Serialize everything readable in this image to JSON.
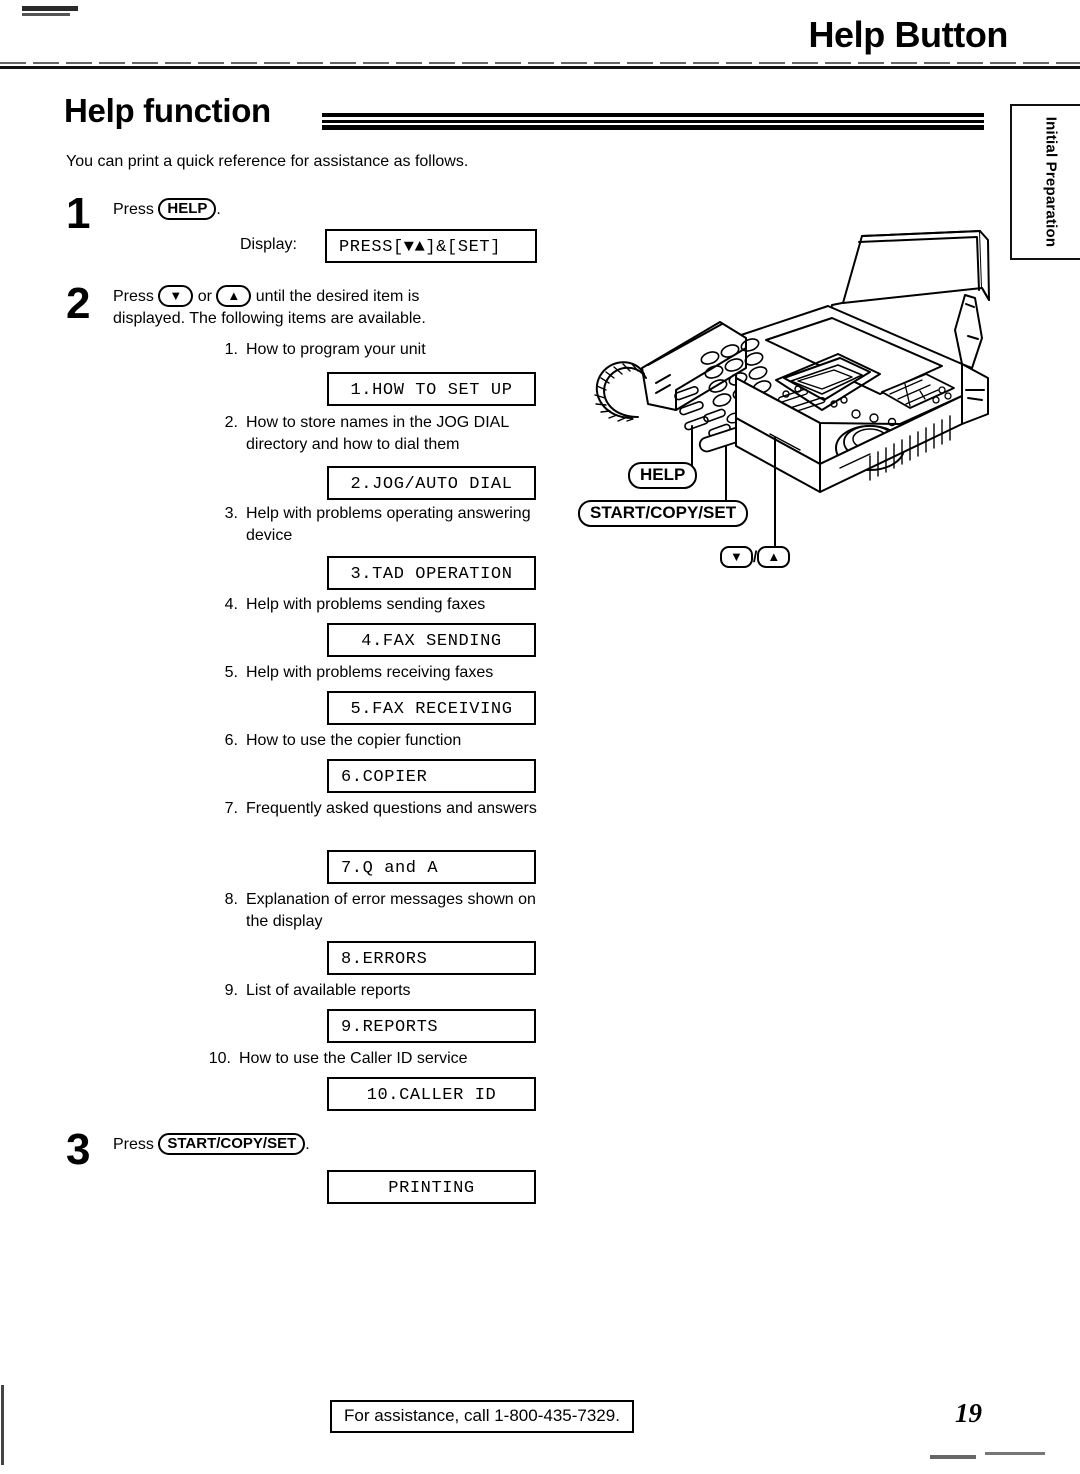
{
  "header": {
    "title": "Help Button"
  },
  "side_tab": {
    "label": "Initial Preparation"
  },
  "section": {
    "title": "Help function",
    "intro": "You can print a quick reference for assistance as follows."
  },
  "steps": {
    "step1": {
      "number": "1",
      "text_before": "Press",
      "key": "HELP",
      "text_after": ".",
      "display_label": "Display:",
      "display_value": "PRESS[▼▲]&[SET]"
    },
    "step2": {
      "number": "2",
      "text_part1": "Press",
      "key_down": "▼",
      "text_or": "or",
      "key_up": "▲",
      "text_part2": "until the desired item is",
      "text_line2": "displayed. The following items are available."
    },
    "step3": {
      "number": "3",
      "text_before": "Press",
      "key": "START/COPY/SET",
      "text_after": ".",
      "display_value": "PRINTING"
    }
  },
  "help_items": [
    {
      "n": "1.",
      "text": "How to program your unit",
      "display": "1.HOW TO SET UP"
    },
    {
      "n": "2.",
      "text": "How to store names in the JOG DIAL directory and how to dial them",
      "display": "2.JOG/AUTO DIAL"
    },
    {
      "n": "3.",
      "text": "Help with problems operating answering device",
      "display": "3.TAD OPERATION"
    },
    {
      "n": "4.",
      "text": "Help with problems sending faxes",
      "display": "4.FAX SENDING"
    },
    {
      "n": "5.",
      "text": "Help with problems receiving faxes",
      "display": "5.FAX RECEIVING"
    },
    {
      "n": "6.",
      "text": "How to use the copier function",
      "display": "6.COPIER"
    },
    {
      "n": "7.",
      "text": "Frequently asked questions and answers",
      "display": "7.Q and A"
    },
    {
      "n": "8.",
      "text": "Explanation of error messages shown on the display",
      "display": "8.ERRORS"
    },
    {
      "n": "9.",
      "text": "List of available reports",
      "display": "9.REPORTS"
    },
    {
      "n": "10.",
      "text": "How to use the Caller ID service",
      "display": "10.CALLER ID"
    }
  ],
  "illustration": {
    "alt": "fax-machine-line-drawing",
    "callouts": {
      "help": "HELP",
      "start_copy_set": "START/COPY/SET",
      "down": "▼",
      "slash": "/",
      "up": "▲"
    }
  },
  "footer": {
    "assistance": "For assistance, call 1-800-435-7329.",
    "page_number": "19"
  }
}
